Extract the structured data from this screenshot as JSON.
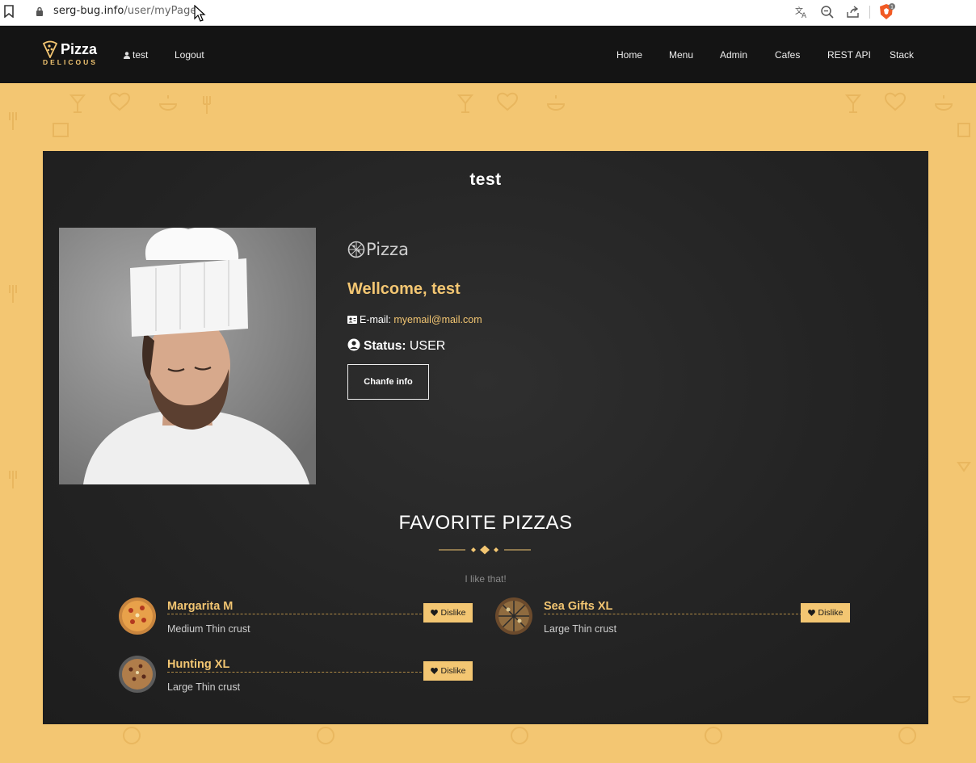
{
  "browser": {
    "url_host": "serg-bug.info",
    "url_path": "/user/myPage",
    "brave_badge": "1"
  },
  "nav": {
    "logo_word": "Pizza",
    "logo_sub": "DELICOUS",
    "user": "test",
    "logout": "Logout",
    "links": [
      "Home",
      "Menu",
      "Admin",
      "Cafes",
      "REST API",
      "Stack"
    ]
  },
  "profile": {
    "title": "test",
    "brand": "Pizza",
    "welcome": "Wellcome, test",
    "email_label": "E-mail:",
    "email": "myemail@mail.com",
    "status_label": "Status:",
    "status": "USER",
    "change_button": "Chanfe info"
  },
  "favorites": {
    "title": "FAVORITE PIZZAS",
    "tagline": "I like that!",
    "dislike_label": "Dislike",
    "items": [
      {
        "name": "Margarita M",
        "desc": "Medium Thin crust"
      },
      {
        "name": "Sea Gifts XL",
        "desc": "Large Thin crust"
      },
      {
        "name": "Hunting XL",
        "desc": "Large Thin crust"
      }
    ]
  },
  "colors": {
    "accent": "#f3c672",
    "nav_bg": "#141414",
    "board_bg": "#242424",
    "page_bg": "#f3c672"
  }
}
